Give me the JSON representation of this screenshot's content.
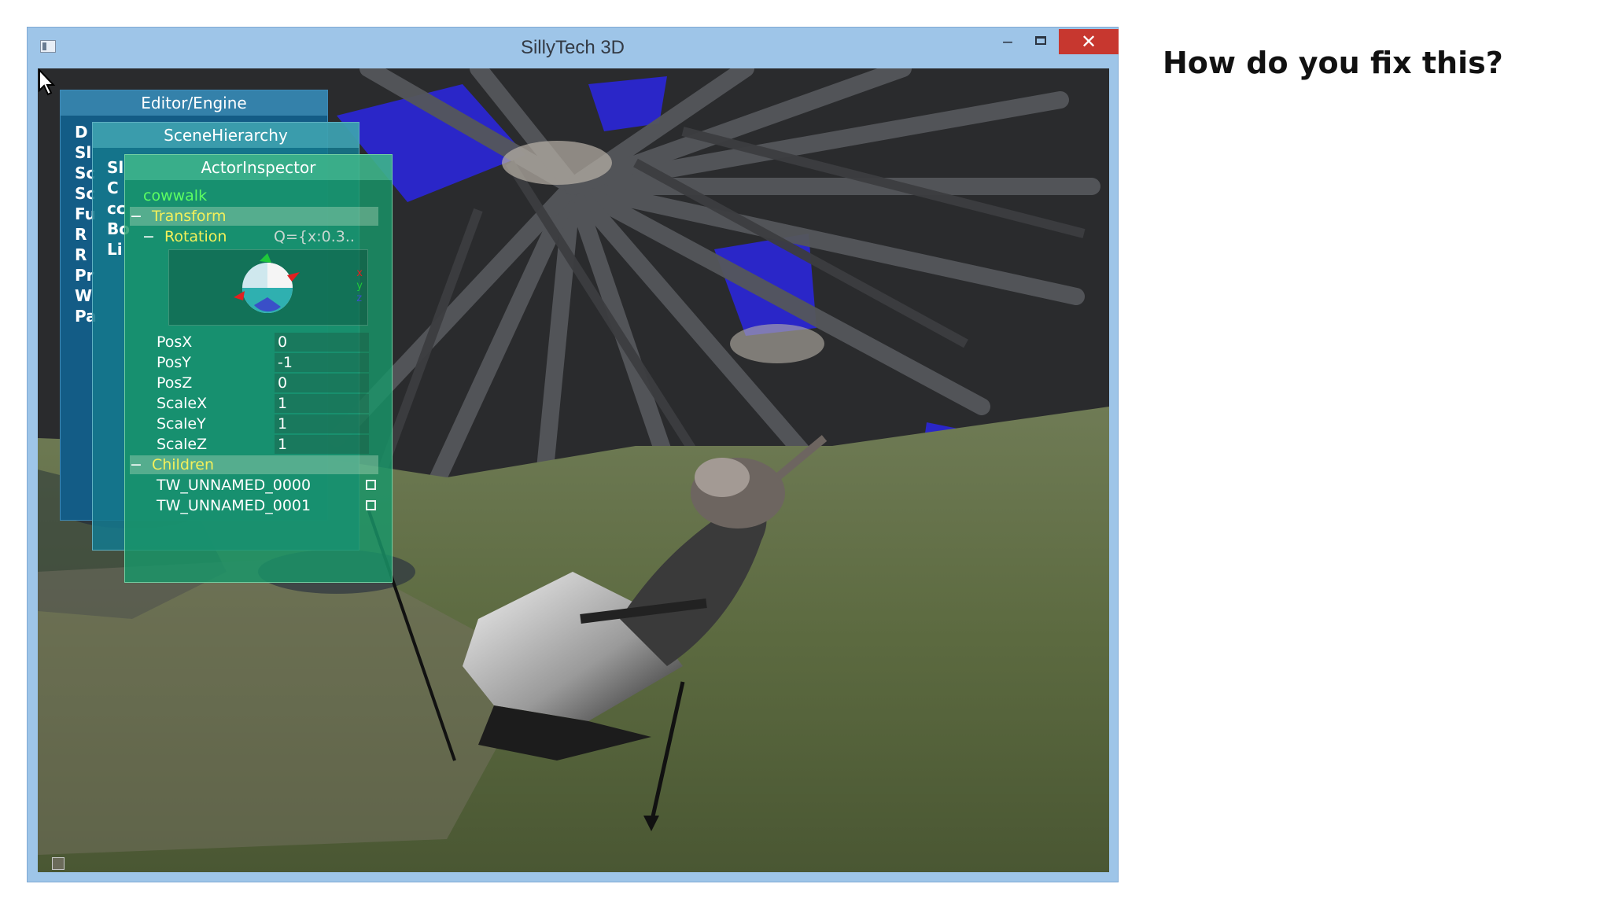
{
  "window": {
    "title": "SillyTech 3D",
    "minimize": "‒",
    "close": "✕"
  },
  "editor_panel": {
    "title": "Editor/Engine",
    "items": [
      "D",
      "Sl",
      "Sc",
      "Sc",
      "Fu",
      "R",
      "R",
      "Pr",
      "W",
      "Pa"
    ]
  },
  "scene_panel": {
    "title": "SceneHierarchy",
    "items": [
      "Sl",
      "C",
      "cc",
      "Bo",
      "Li"
    ]
  },
  "actor_panel": {
    "title": "ActorInspector",
    "object_name": "cowwalk",
    "transform": {
      "toggle": "−",
      "label": "Transform"
    },
    "rotation": {
      "toggle": "−",
      "label": "Rotation",
      "value": "Q={x:0.3.."
    },
    "axes": [
      "x",
      "y",
      "z"
    ],
    "properties": [
      {
        "label": "PosX",
        "value": "0"
      },
      {
        "label": "PosY",
        "value": "-1"
      },
      {
        "label": "PosZ",
        "value": "0"
      },
      {
        "label": "ScaleX",
        "value": "1"
      },
      {
        "label": "ScaleY",
        "value": "1"
      },
      {
        "label": "ScaleZ",
        "value": "1"
      }
    ],
    "children": {
      "toggle": "−",
      "label": "Children",
      "items": [
        "TW_UNNAMED_0000",
        "TW_UNNAMED_0001"
      ]
    }
  },
  "side_text": "How do you fix this?"
}
